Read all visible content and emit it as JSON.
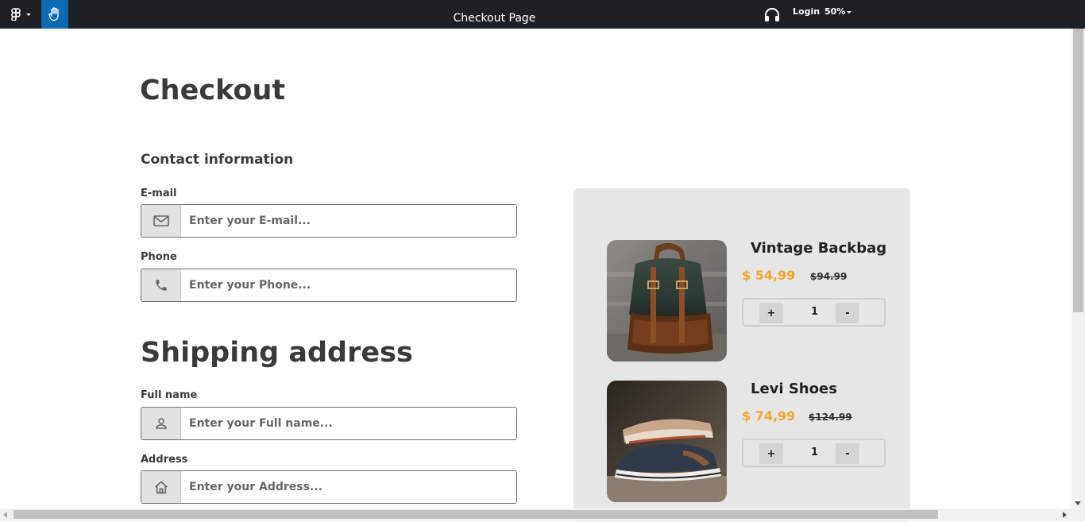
{
  "topbar": {
    "title": "Checkout Page",
    "login_label": "Login",
    "zoom": "50%"
  },
  "page": {
    "heading": "Checkout",
    "contact_heading": "Contact information",
    "shipping_heading": "Shipping address"
  },
  "form": {
    "email": {
      "label": "E-mail",
      "placeholder": "Enter your E-mail..."
    },
    "phone": {
      "label": "Phone",
      "placeholder": "Enter your Phone..."
    },
    "fullname": {
      "label": "Full name",
      "placeholder": "Enter your Full name..."
    },
    "address": {
      "label": "Address",
      "placeholder": "Enter your Address..."
    }
  },
  "cart": {
    "items": [
      {
        "name": "Vintage Backbag",
        "price": "$ 54,99",
        "old_price": "$94.99",
        "quantity": "1",
        "plus": "+",
        "minus": "-"
      },
      {
        "name": "Levi Shoes",
        "price": "$ 74,99",
        "old_price": "$124.99",
        "quantity": "1",
        "plus": "+",
        "minus": "-"
      }
    ]
  },
  "colors": {
    "accent_price": "#f6a52a",
    "topbar_bg": "#1e2124",
    "hand_tool_bg": "#0c6bb3",
    "panel_bg": "#e6e6e6"
  }
}
